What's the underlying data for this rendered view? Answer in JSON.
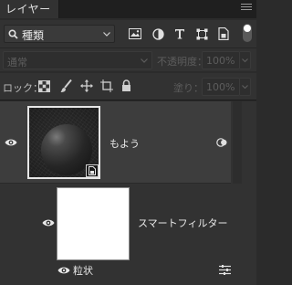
{
  "panel": {
    "tab_title": "レイヤー"
  },
  "filter": {
    "kind_label": "種類"
  },
  "blend": {
    "mode": "通常",
    "opacity_label": "不透明度：",
    "opacity_value": "100%",
    "fill_label": "塗り：",
    "fill_value": "100%"
  },
  "lock": {
    "label": "ロック："
  },
  "layers": {
    "main": {
      "name": "もよう"
    },
    "smart_filters_label": "スマートフィルター",
    "filter_item": {
      "name": "粒状"
    }
  },
  "colors": {
    "panel_bg": "#323232",
    "selected_row_bg": "#3d3d3d",
    "header_bg": "#1f1f1f"
  }
}
